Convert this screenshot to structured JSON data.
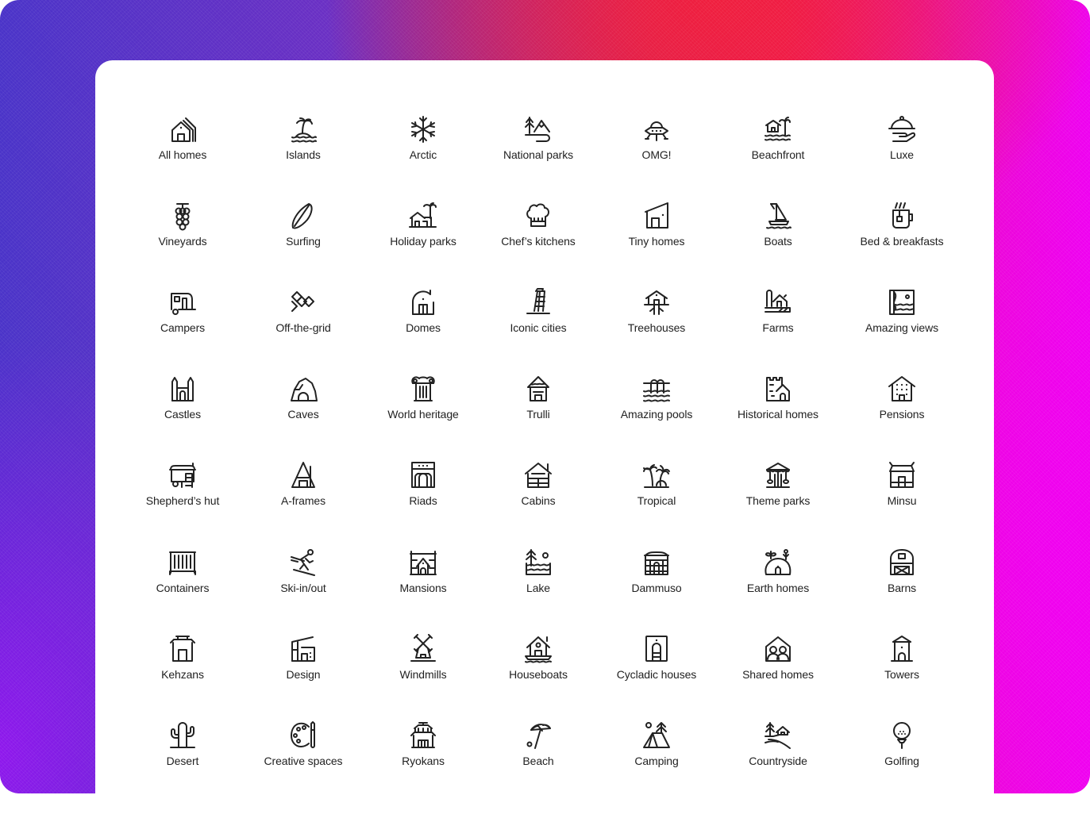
{
  "background": {
    "gradient_colors": [
      "#4a33c8",
      "#f0155a",
      "#ee00f0"
    ]
  },
  "categories": [
    {
      "label": "All homes",
      "icon": "houses-icon"
    },
    {
      "label": "Islands",
      "icon": "island-palm-icon"
    },
    {
      "label": "Arctic",
      "icon": "snowflake-icon"
    },
    {
      "label": "National parks",
      "icon": "mountain-tree-icon"
    },
    {
      "label": "OMG!",
      "icon": "ufo-icon"
    },
    {
      "label": "Beachfront",
      "icon": "beach-hut-icon"
    },
    {
      "label": "Luxe",
      "icon": "cloche-icon"
    },
    {
      "label": "Vineyards",
      "icon": "grapes-icon"
    },
    {
      "label": "Surfing",
      "icon": "surfboard-icon"
    },
    {
      "label": "Holiday parks",
      "icon": "holiday-house-icon"
    },
    {
      "label": "Chef’s kitchens",
      "icon": "chef-hat-icon"
    },
    {
      "label": "Tiny homes",
      "icon": "tiny-home-icon"
    },
    {
      "label": "Boats",
      "icon": "sailboat-icon"
    },
    {
      "label": "Bed & breakfasts",
      "icon": "mug-icon"
    },
    {
      "label": "Campers",
      "icon": "camper-icon"
    },
    {
      "label": "Off-the-grid",
      "icon": "diamonds-icon"
    },
    {
      "label": "Domes",
      "icon": "dome-icon"
    },
    {
      "label": "Iconic cities",
      "icon": "leaning-tower-icon"
    },
    {
      "label": "Treehouses",
      "icon": "treehouse-icon"
    },
    {
      "label": "Farms",
      "icon": "farm-icon"
    },
    {
      "label": "Amazing views",
      "icon": "view-frame-icon"
    },
    {
      "label": "Castles",
      "icon": "castle-icon"
    },
    {
      "label": "Caves",
      "icon": "cave-icon"
    },
    {
      "label": "World heritage",
      "icon": "column-icon"
    },
    {
      "label": "Trulli",
      "icon": "trullo-icon"
    },
    {
      "label": "Amazing pools",
      "icon": "pool-icon"
    },
    {
      "label": "Historical homes",
      "icon": "historic-house-icon"
    },
    {
      "label": "Pensions",
      "icon": "pension-icon"
    },
    {
      "label": "Shepherd’s hut",
      "icon": "shepherd-hut-icon"
    },
    {
      "label": "A-frames",
      "icon": "a-frame-icon"
    },
    {
      "label": "Riads",
      "icon": "riad-icon"
    },
    {
      "label": "Cabins",
      "icon": "cabin-icon"
    },
    {
      "label": "Tropical",
      "icon": "palm-trees-icon"
    },
    {
      "label": "Theme parks",
      "icon": "carousel-icon"
    },
    {
      "label": "Minsu",
      "icon": "minsu-icon"
    },
    {
      "label": "Containers",
      "icon": "container-icon"
    },
    {
      "label": "Ski-in/out",
      "icon": "skier-icon"
    },
    {
      "label": "Mansions",
      "icon": "mansion-icon"
    },
    {
      "label": "Lake",
      "icon": "lake-icon"
    },
    {
      "label": "Dammuso",
      "icon": "dammuso-icon"
    },
    {
      "label": "Earth homes",
      "icon": "earth-home-icon"
    },
    {
      "label": "Barns",
      "icon": "barn-icon"
    },
    {
      "label": "Kehzans",
      "icon": "pagoda-icon"
    },
    {
      "label": "Design",
      "icon": "design-house-icon"
    },
    {
      "label": "Windmills",
      "icon": "windmill-icon"
    },
    {
      "label": "Houseboats",
      "icon": "houseboat-icon"
    },
    {
      "label": "Cycladic houses",
      "icon": "cycladic-door-icon"
    },
    {
      "label": "Shared homes",
      "icon": "shared-home-icon"
    },
    {
      "label": "Towers",
      "icon": "tower-icon"
    },
    {
      "label": "Desert",
      "icon": "cactus-icon"
    },
    {
      "label": "Creative spaces",
      "icon": "palette-icon"
    },
    {
      "label": "Ryokans",
      "icon": "ryokan-icon"
    },
    {
      "label": "Beach",
      "icon": "umbrella-icon"
    },
    {
      "label": "Camping",
      "icon": "tent-icon"
    },
    {
      "label": "Countryside",
      "icon": "countryside-icon"
    },
    {
      "label": "Golfing",
      "icon": "golf-ball-icon"
    }
  ]
}
